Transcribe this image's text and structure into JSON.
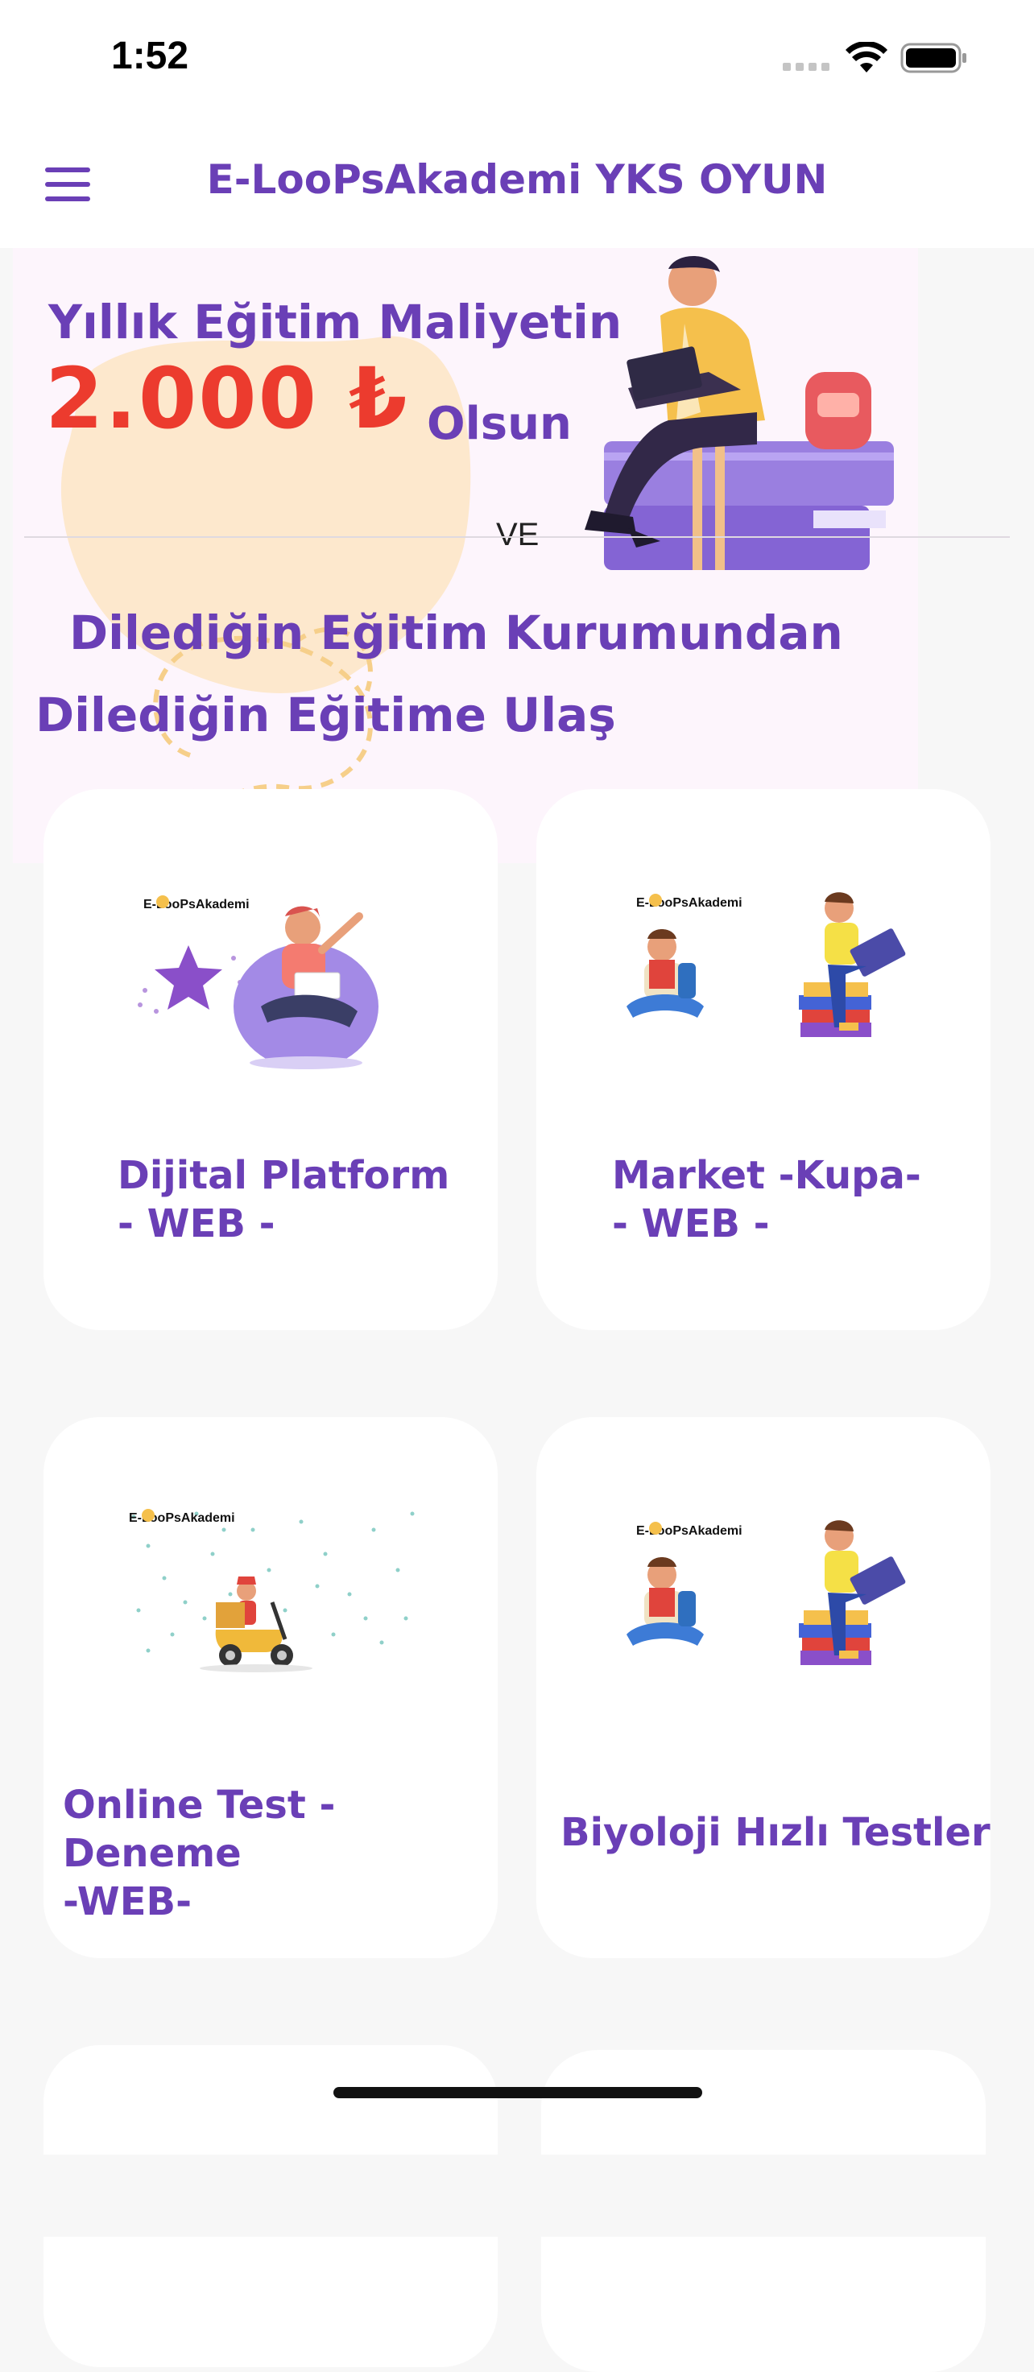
{
  "status_bar": {
    "time": "1:52"
  },
  "header": {
    "title": "E-LooPsAkademi YKS OYUN"
  },
  "banner": {
    "line1": "Yıllık Eğitim Maliyetin",
    "price": "2.000 ₺",
    "line2_suffix": "Olsun",
    "separator": "VE",
    "line3": "Dilediğin Eğitim Kurumundan",
    "line4": "Dilediğin Eğitime Ulaş"
  },
  "cards": [
    {
      "label": "Dijital Platform\n- WEB -",
      "logo": "E-LooPsAkademi",
      "icon": "student-laptop-illustration"
    },
    {
      "label": "Market -Kupa-\n- WEB -",
      "logo": "E-LooPsAkademi",
      "icon": "students-reading-illustration"
    },
    {
      "label": "Online Test - Deneme\n-WEB-",
      "logo": "E-LooPsAkademi",
      "icon": "scooter-delivery-illustration"
    },
    {
      "label": "Biyoloji Hızlı Testler",
      "logo": "E-LooPsAkademi",
      "icon": "students-reading-illustration"
    }
  ],
  "colors": {
    "accent": "#6a3fb6",
    "price": "#ec3b2e",
    "banner_bg": "#fdf5fc"
  }
}
